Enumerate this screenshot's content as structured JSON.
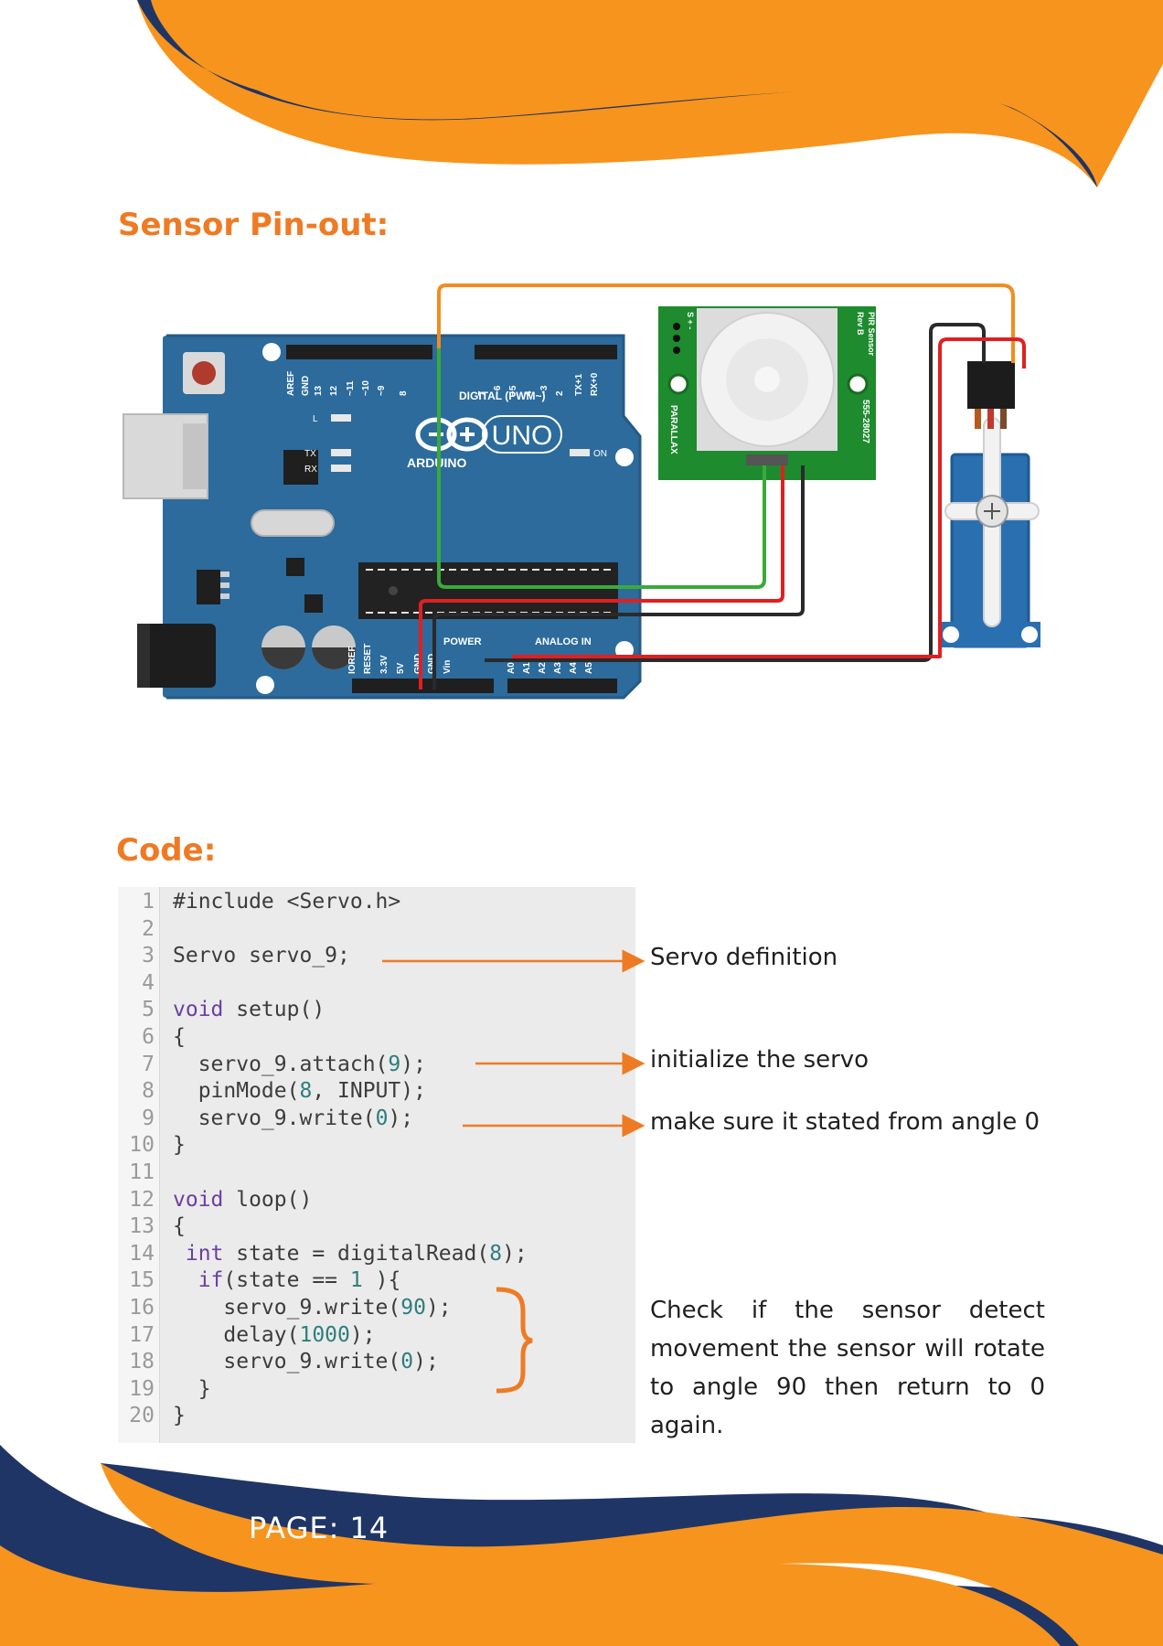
{
  "headings": {
    "pinout": "Sensor Pin-out:",
    "code": "Code:"
  },
  "board": {
    "brand": "ARDUINO",
    "model": "UNO",
    "digital_header": "DIGITAL (PWM~)",
    "power_header": "POWER",
    "analog_header": "ANALOG IN",
    "led_l": "L",
    "led_tx": "TX",
    "led_rx": "RX",
    "led_on": "ON",
    "pins_top": [
      "AREF",
      "GND",
      "13",
      "12",
      "~11",
      "~10",
      "~9",
      "8",
      "7",
      "~6",
      "~5",
      "4",
      "~3",
      "2",
      "TX+1",
      "RX+0"
    ],
    "pins_bottom": [
      "IOREF",
      "RESET",
      "3.3V",
      "5V",
      "GND",
      "GND",
      "Vin",
      "A0",
      "A1",
      "A2",
      "A3",
      "A4",
      "A5"
    ]
  },
  "pir": {
    "label_top": "PIR Sensor",
    "label_rev": "Rev B",
    "brand": "PARALLAX",
    "part": "555-28027",
    "pins": "S + -"
  },
  "code_lines": [
    "#include <Servo.h>",
    "",
    "Servo servo_9;",
    "",
    "void setup()",
    "{",
    "  servo_9.attach(9);",
    "  pinMode(8, INPUT);",
    "  servo_9.write(0);",
    "}",
    "",
    "void loop()",
    "{",
    " int state = digitalRead(8);",
    "  if(state == 1 ){",
    "    servo_9.write(90);",
    "    delay(1000);",
    "    servo_9.write(0);",
    "  }",
    "}"
  ],
  "annotations": {
    "servo_def": "Servo definition",
    "init_servo": "initialize the servo",
    "angle_zero": "make sure it stated from angle 0",
    "check_sensor": "Check if the sensor detect movement the sensor will rotate to angle 90 then return to 0 again."
  },
  "footer": {
    "page_label": "PAGE: 14"
  },
  "colors": {
    "orange": "#f7941d",
    "navy": "#1f3566",
    "accent": "#ee7b24",
    "board_blue": "#2c6b9c",
    "pir_green": "#1e8b2e"
  }
}
